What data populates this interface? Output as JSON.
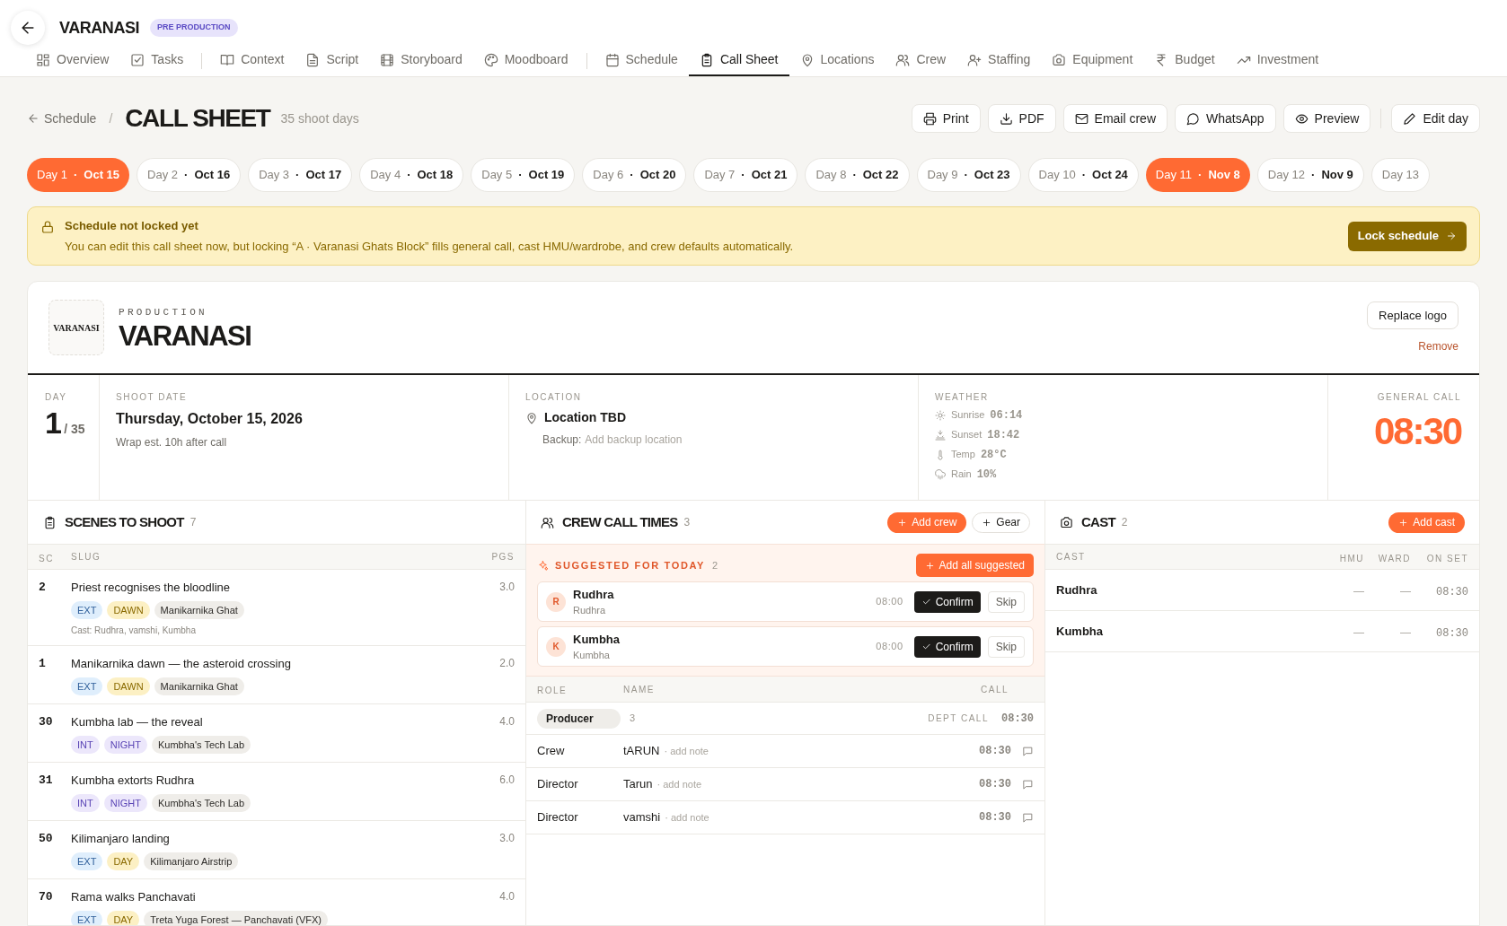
{
  "app": {
    "title": "VARANASI",
    "badge": "PRE PRODUCTION"
  },
  "tab_groups": [
    [
      {
        "label": "Overview",
        "selected": false
      },
      {
        "label": "Tasks",
        "selected": false
      }
    ],
    [
      {
        "label": "Context",
        "selected": false
      },
      {
        "label": "Script",
        "selected": false
      },
      {
        "label": "Storyboard",
        "selected": false
      },
      {
        "label": "Moodboard",
        "selected": false
      }
    ],
    [
      {
        "label": "Schedule",
        "selected": false
      },
      {
        "label": "Call Sheet",
        "selected": true
      },
      {
        "label": "Locations",
        "selected": false
      },
      {
        "label": "Crew",
        "selected": false
      },
      {
        "label": "Staffing",
        "selected": false
      },
      {
        "label": "Equipment",
        "selected": false
      },
      {
        "label": "Budget",
        "selected": false
      },
      {
        "label": "Investment",
        "selected": false
      }
    ]
  ],
  "toolbar": {
    "back_link": "Schedule",
    "separator": "/",
    "title": "CALL SHEET",
    "subtitle": "35 shoot days",
    "actions": [
      "Print",
      "PDF",
      "Email crew",
      "WhatsApp",
      "Preview"
    ],
    "edit_button": "Edit day"
  },
  "day_separator": "·",
  "days": [
    {
      "day": "Day 1",
      "date": "Oct 15",
      "selected": true
    },
    {
      "day": "Day 2",
      "date": "Oct 16",
      "selected": false
    },
    {
      "day": "Day 3",
      "date": "Oct 17",
      "selected": false
    },
    {
      "day": "Day 4",
      "date": "Oct 18",
      "selected": false
    },
    {
      "day": "Day 5",
      "date": "Oct 19",
      "selected": false
    },
    {
      "day": "Day 6",
      "date": "Oct 20",
      "selected": false
    },
    {
      "day": "Day 7",
      "date": "Oct 21",
      "selected": false
    },
    {
      "day": "Day 8",
      "date": "Oct 22",
      "selected": false
    },
    {
      "day": "Day 9",
      "date": "Oct 23",
      "selected": false
    },
    {
      "day": "Day 10",
      "date": "Oct 24",
      "selected": false
    },
    {
      "day": "Day 11",
      "date": "Nov 8",
      "selected": true
    },
    {
      "day": "Day 12",
      "date": "Nov 9",
      "selected": false
    },
    {
      "day": "Day 13",
      "selected": false
    }
  ],
  "banner": {
    "title": "Schedule not locked yet",
    "message": "You can edit this call sheet now, but locking “A · Varanasi Ghats Block” fills general call, cast HMU/wardrobe, and crew defaults automatically.",
    "button": "Lock schedule"
  },
  "production": {
    "label": "PRODUCTION",
    "name": "VARANASI",
    "logo_text": "VARANASI",
    "replace_button": "Replace logo",
    "remove_link": "Remove"
  },
  "info": {
    "day_label": "DAY",
    "day": "1",
    "day_total": "/ 35",
    "date_label": "SHOOT DATE",
    "date": "Thursday, October 15, 2026",
    "wrap": "Wrap est. 10h after call",
    "location_label": "LOCATION",
    "location": "Location TBD",
    "backup_label": "Backup:",
    "backup_placeholder": "Add backup location",
    "weather_label": "WEATHER",
    "weather": [
      {
        "label": "Sunrise",
        "value": "06:14"
      },
      {
        "label": "Sunset",
        "value": "18:42"
      },
      {
        "label": "Temp",
        "value": "28°C"
      },
      {
        "label": "Rain",
        "value": "10%"
      }
    ],
    "general_call_label": "GENERAL CALL",
    "general_call": "08:30"
  },
  "scenes": {
    "title": "SCENES TO SHOOT",
    "count": "7",
    "columns": [
      "SC",
      "SLUG",
      "PGS"
    ],
    "rows": [
      {
        "sc": "2",
        "slug": "Priest recognises the bloodline",
        "pages": "3.0",
        "tags": [
          {
            "text": "EXT",
            "kind": "ext"
          },
          {
            "text": "DAWN",
            "kind": "day"
          },
          {
            "text": "Manikarnika Ghat",
            "kind": "set"
          }
        ],
        "cast": "Cast: Rudhra, vamshi, Kumbha"
      },
      {
        "sc": "1",
        "slug": "Manikarnika dawn — the asteroid crossing",
        "pages": "2.0",
        "tags": [
          {
            "text": "EXT",
            "kind": "ext"
          },
          {
            "text": "DAWN",
            "kind": "day"
          },
          {
            "text": "Manikarnika Ghat",
            "kind": "set"
          }
        ]
      },
      {
        "sc": "30",
        "slug": "Kumbha lab — the reveal",
        "pages": "4.0",
        "tags": [
          {
            "text": "INT",
            "kind": "int"
          },
          {
            "text": "NIGHT",
            "kind": "int"
          },
          {
            "text": "Kumbha's Tech Lab",
            "kind": "set"
          }
        ]
      },
      {
        "sc": "31",
        "slug": "Kumbha extorts Rudhra",
        "pages": "6.0",
        "tags": [
          {
            "text": "INT",
            "kind": "int"
          },
          {
            "text": "NIGHT",
            "kind": "int"
          },
          {
            "text": "Kumbha's Tech Lab",
            "kind": "set"
          }
        ]
      },
      {
        "sc": "50",
        "slug": "Kilimanjaro landing",
        "pages": "3.0",
        "tags": [
          {
            "text": "EXT",
            "kind": "ext"
          },
          {
            "text": "DAY",
            "kind": "day"
          },
          {
            "text": "Kilimanjaro Airstrip",
            "kind": "set"
          }
        ]
      },
      {
        "sc": "70",
        "slug": "Rama walks Panchavati",
        "pages": "4.0",
        "tags": [
          {
            "text": "EXT",
            "kind": "ext"
          },
          {
            "text": "DAY",
            "kind": "day"
          },
          {
            "text": "Treta Yuga Forest — Panchavati (VFX)",
            "kind": "set"
          }
        ]
      }
    ]
  },
  "crew": {
    "title": "CREW CALL TIMES",
    "count": "3",
    "add_button": "Add crew",
    "gear_button": "Gear",
    "suggested": {
      "title": "SUGGESTED FOR TODAY",
      "count": "2",
      "add_all": "Add all suggested",
      "people": [
        {
          "initial": "R",
          "name": "Rudhra",
          "subtitle": "Rudhra",
          "time": "08:00",
          "confirm": "Confirm",
          "skip": "Skip"
        },
        {
          "initial": "K",
          "name": "Kumbha",
          "subtitle": "Kumbha",
          "time": "08:00",
          "confirm": "Confirm",
          "skip": "Skip"
        }
      ]
    },
    "columns": [
      "ROLE",
      "NAME",
      "CALL"
    ],
    "departments": [
      {
        "name": "Producer",
        "count": "3",
        "dept_call_label": "DEPT CALL",
        "dept_call": "08:30",
        "members": [
          {
            "role": "Crew",
            "name": "tARUN",
            "note": "· add note",
            "call": "08:30"
          },
          {
            "role": "Director",
            "name": "Tarun",
            "note": "· add note",
            "call": "08:30"
          },
          {
            "role": "Director",
            "name": "vamshi",
            "note": "· add note",
            "call": "08:30"
          }
        ]
      }
    ]
  },
  "cast": {
    "title": "CAST",
    "count": "2",
    "add_button": "Add cast",
    "columns": [
      "CAST",
      "HMU",
      "WARD",
      "ON SET"
    ],
    "rows": [
      {
        "name": "Rudhra",
        "hmu": "—",
        "ward": "—",
        "on_set": "08:30"
      },
      {
        "name": "Kumbha",
        "hmu": "—",
        "ward": "—",
        "on_set": "08:30"
      }
    ]
  }
}
